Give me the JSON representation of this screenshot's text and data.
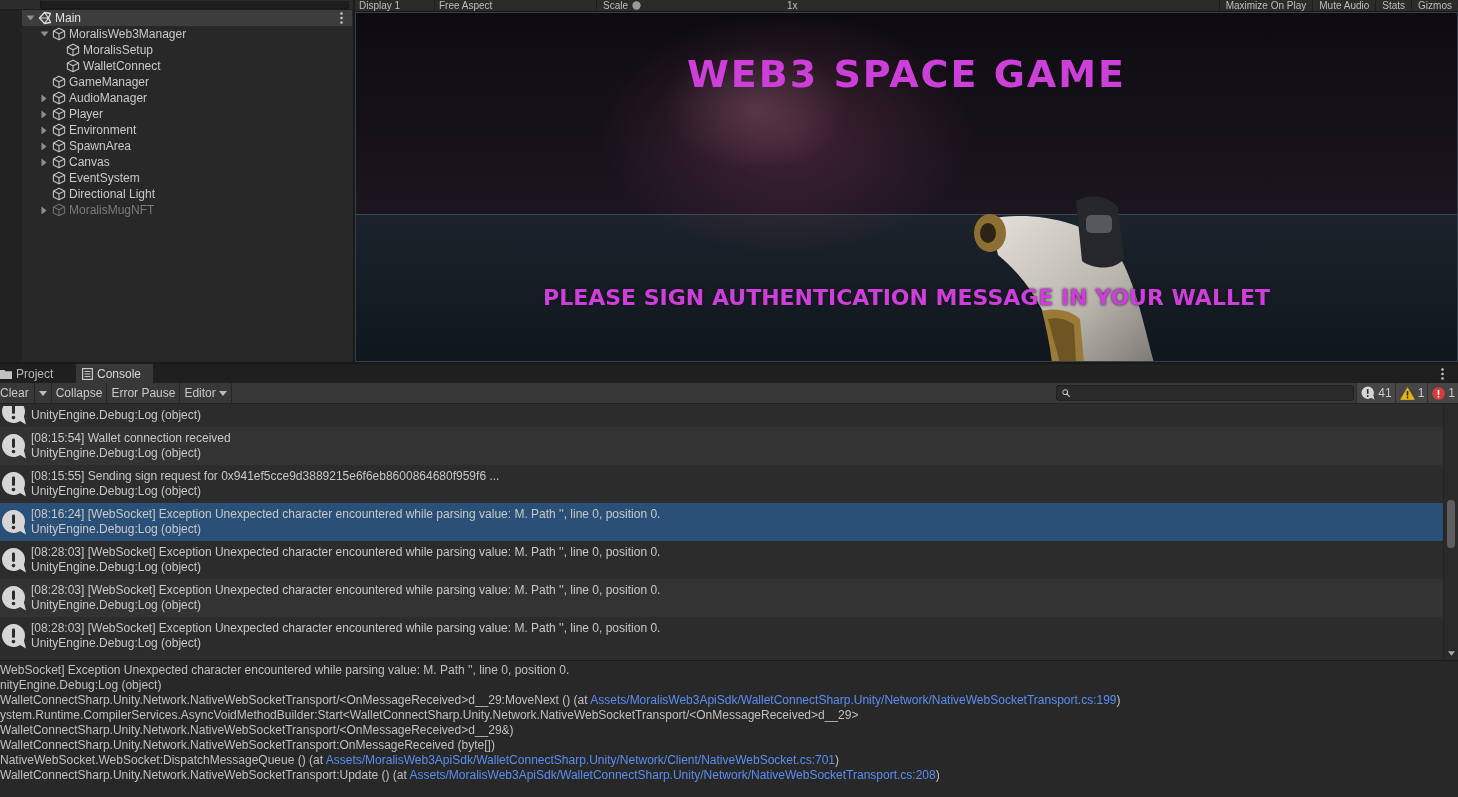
{
  "hierarchy": {
    "scene": {
      "name": "Main",
      "expanded": true
    },
    "items": [
      {
        "name": "MoralisWeb3Manager",
        "expanded": true,
        "active": true,
        "children": [
          {
            "name": "MoralisSetup",
            "active": true
          },
          {
            "name": "WalletConnect",
            "active": true
          }
        ]
      },
      {
        "name": "GameManager",
        "active": true
      },
      {
        "name": "AudioManager",
        "expanded": false,
        "active": true
      },
      {
        "name": "Player",
        "expanded": false,
        "active": true
      },
      {
        "name": "Environment",
        "expanded": false,
        "active": true
      },
      {
        "name": "SpawnArea",
        "expanded": false,
        "active": true
      },
      {
        "name": "Canvas",
        "expanded": false,
        "active": true
      },
      {
        "name": "EventSystem",
        "active": true
      },
      {
        "name": "Directional Light",
        "active": true
      },
      {
        "name": "MoralisMugNFT",
        "expanded": false,
        "active": false
      }
    ]
  },
  "game_view": {
    "toolbar_left": [
      {
        "kind": "dropdown",
        "label": "Display 1"
      },
      {
        "kind": "dropdown",
        "label": "Free Aspect"
      },
      {
        "kind": "slider",
        "label": "Scale",
        "value": "1x"
      }
    ],
    "toolbar_right": [
      {
        "kind": "toggle",
        "label": "Maximize On Play"
      },
      {
        "kind": "toggle",
        "label": "Mute Audio"
      },
      {
        "kind": "toggle",
        "label": "Stats"
      },
      {
        "kind": "toggle",
        "label": "Gizmos"
      }
    ],
    "title": "WEB3 SPACE GAME",
    "message": "PLEASE SIGN AUTHENTICATION MESSAGE IN YOUR WALLET"
  },
  "console": {
    "tabs": [
      {
        "kind": "project",
        "label": "Project",
        "selected": false
      },
      {
        "kind": "console",
        "label": "Console",
        "selected": true
      }
    ],
    "toolbar": [
      {
        "kind": "button",
        "label": "Clear"
      },
      {
        "kind": "menu"
      },
      {
        "kind": "toggle",
        "label": "Collapse",
        "on": false
      },
      {
        "kind": "toggle",
        "label": "Error Pause",
        "on": false
      },
      {
        "kind": "dropdown",
        "label": "Editor"
      }
    ],
    "counters": [
      {
        "kind": "info",
        "count": "41"
      },
      {
        "kind": "warning",
        "count": "1"
      },
      {
        "kind": "error",
        "count": "1"
      }
    ],
    "entries": [
      {
        "kind": "info",
        "trace": "UnityEngine.Debug:Log (object)",
        "selected": false
      },
      {
        "kind": "info",
        "message": "[08:15:54] Wallet connection received",
        "trace": "UnityEngine.Debug:Log (object)",
        "selected": false
      },
      {
        "kind": "info",
        "message": "[08:15:55] Sending sign request for 0x941ef5cce9d3889215e6f6eb8600864680f959f6 ...",
        "trace": "UnityEngine.Debug:Log (object)",
        "selected": false
      },
      {
        "kind": "info",
        "message": "[08:16:24] [WebSocket] Exception Unexpected character encountered while parsing value: M. Path '', line 0, position 0.",
        "trace": "UnityEngine.Debug:Log (object)",
        "selected": true
      },
      {
        "kind": "info",
        "message": "[08:28:03] [WebSocket] Exception Unexpected character encountered while parsing value: M. Path '', line 0, position 0.",
        "trace": "UnityEngine.Debug:Log (object)",
        "selected": false
      },
      {
        "kind": "info",
        "message": "[08:28:03] [WebSocket] Exception Unexpected character encountered while parsing value: M. Path '', line 0, position 0.",
        "trace": "UnityEngine.Debug:Log (object)",
        "selected": false
      },
      {
        "kind": "info",
        "message": "[08:28:03] [WebSocket] Exception Unexpected character encountered while parsing value: M. Path '', line 0, position 0.",
        "trace": "UnityEngine.Debug:Log (object)",
        "selected": false
      }
    ],
    "detail": [
      {
        "text": "WebSocket] Exception Unexpected character encountered while parsing value: M. Path '', line 0, position 0."
      },
      {
        "text": "nityEngine.Debug:Log (object)"
      },
      {
        "text": "WalletConnectSharp.Unity.Network.NativeWebSocketTransport/<OnMessageReceived>d__29:MoveNext () (at ",
        "link": "Assets/MoralisWeb3ApiSdk/WalletConnectSharp.Unity/Network/NativeWebSocketTransport.cs:199",
        "tail": ")"
      },
      {
        "text": "ystem.Runtime.CompilerServices.AsyncVoidMethodBuilder:Start<WalletConnectSharp.Unity.Network.NativeWebSocketTransport/<OnMessageReceived>d__29>"
      },
      {
        "text": "WalletConnectSharp.Unity.Network.NativeWebSocketTransport/<OnMessageReceived>d__29&)"
      },
      {
        "text": "WalletConnectSharp.Unity.Network.NativeWebSocketTransport:OnMessageReceived (byte[])"
      },
      {
        "text": "NativeWebSocket.WebSocket:DispatchMessageQueue () (at ",
        "link": "Assets/MoralisWeb3ApiSdk/WalletConnectSharp.Unity/Network/Client/NativeWebSocket.cs:701",
        "tail": ")"
      },
      {
        "text": "WalletConnectSharp.Unity.Network.NativeWebSocketTransport:Update () (at ",
        "link": "Assets/MoralisWeb3ApiSdk/WalletConnectSharp.Unity/Network/NativeWebSocketTransport.cs:208",
        "tail": ")"
      }
    ]
  }
}
